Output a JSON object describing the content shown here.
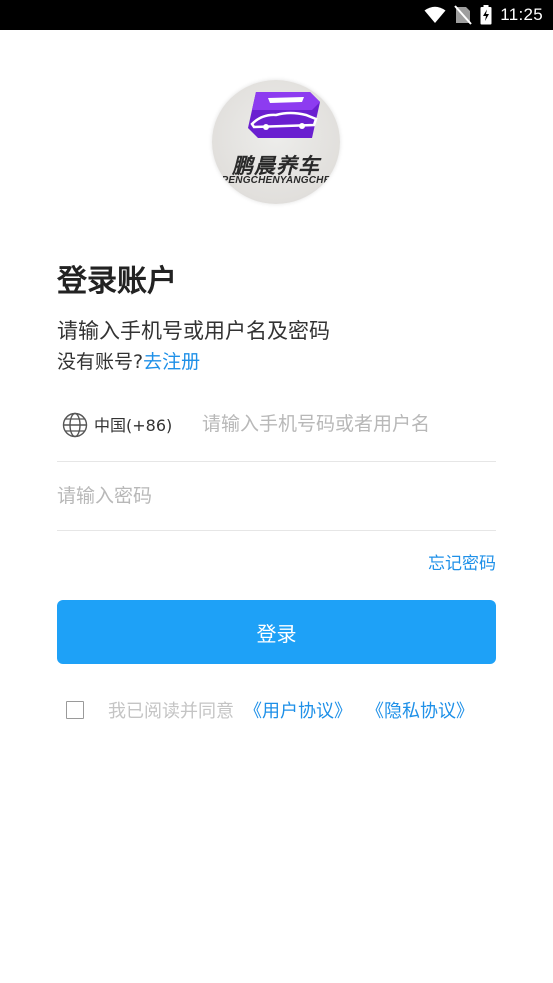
{
  "status_bar": {
    "time": "11:25",
    "icons": [
      "wifi-icon",
      "no-sim-icon",
      "battery-charging-icon"
    ]
  },
  "logo": {
    "name_cn": "鹏晨养车",
    "name_en": "PENGCHENYANGCHE",
    "colors": {
      "badge": "#6a1fd0",
      "badge_light": "#8d3cf0",
      "text": "#2a2a2a"
    }
  },
  "login": {
    "title": "登录账户",
    "subtitle": "请输入手机号或用户名及密码",
    "no_account_text": "没有账号?",
    "register_link": "去注册",
    "country_code": "中国(+86)",
    "phone_placeholder": "请输入手机号码或者用户名",
    "password_placeholder": "请输入密码",
    "forgot_password": "忘记密码",
    "login_button": "登录",
    "agree_text": "我已阅读并同意",
    "user_agreement": "《用户协议》",
    "privacy_agreement": "《隐私协议》"
  },
  "colors": {
    "accent": "#1ea1f7",
    "link": "#1e90e8",
    "placeholder": "#b8b8b8",
    "divider": "#e6e6e6"
  }
}
